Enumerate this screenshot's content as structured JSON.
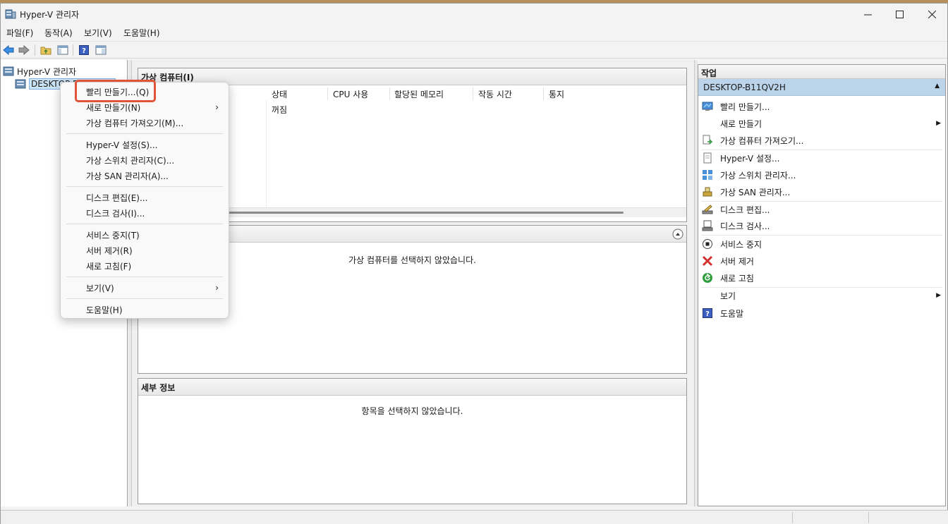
{
  "window": {
    "title": "Hyper-V 관리자"
  },
  "menubar": [
    "파일(F)",
    "동작(A)",
    "보기(V)",
    "도움말(H)"
  ],
  "tree": {
    "root": "Hyper-V 관리자",
    "server": "DESKTOP-B11QV2H"
  },
  "vm_panel": {
    "title": "가상 컴퓨터(I)",
    "columns": [
      "상태",
      "CPU 사용",
      "할당된 메모리",
      "작동 시간",
      "통지"
    ],
    "row_state": "꺼짐"
  },
  "checkpoint_panel": {
    "message": "가상 컴퓨터를 선택하지 않았습니다."
  },
  "details_panel": {
    "title": "세부 정보",
    "message": "항목을 선택하지 않았습니다."
  },
  "actions": {
    "title": "작업",
    "group": "DESKTOP-B11QV2H",
    "items": [
      {
        "label": "빨리 만들기...",
        "icon": "quick-create-icon"
      },
      {
        "label": "새로 만들기",
        "icon": "none",
        "submenu": true
      },
      {
        "label": "가상 컴퓨터 가져오기...",
        "icon": "import-vm-icon"
      },
      {
        "label": "Hyper-V 설정...",
        "icon": "settings-doc-icon"
      },
      {
        "label": "가상 스위치 관리자...",
        "icon": "virtual-switch-icon"
      },
      {
        "label": "가상 SAN 관리자...",
        "icon": "virtual-san-icon"
      },
      {
        "label": "디스크 편집...",
        "icon": "edit-disk-icon"
      },
      {
        "label": "디스크 검사...",
        "icon": "inspect-disk-icon"
      },
      {
        "label": "서비스 중지",
        "icon": "stop-service-icon"
      },
      {
        "label": "서버 제거",
        "icon": "remove-server-icon"
      },
      {
        "label": "새로 고침",
        "icon": "refresh-icon"
      },
      {
        "label": "보기",
        "icon": "none",
        "submenu": true
      },
      {
        "label": "도움말",
        "icon": "help-icon"
      }
    ]
  },
  "context_menu": {
    "items": [
      {
        "label": "빨리 만들기...(Q)"
      },
      {
        "label": "새로 만들기(N)",
        "submenu": true
      },
      {
        "label": "가상 컴퓨터 가져오기(M)..."
      },
      {
        "label": "Hyper-V 설정(S)..."
      },
      {
        "label": "가상 스위치 관리자(C)..."
      },
      {
        "label": "가상 SAN 관리자(A)..."
      },
      {
        "label": "디스크 편집(E)..."
      },
      {
        "label": "디스크 검사(I)..."
      },
      {
        "label": "서비스 중지(T)"
      },
      {
        "label": "서버 제거(R)"
      },
      {
        "label": "새로 고침(F)"
      },
      {
        "label": "보기(V)",
        "submenu": true
      },
      {
        "label": "도움말(H)"
      }
    ],
    "highlight_color": "#e0553a"
  },
  "colors": {
    "selection": "#cce4f7",
    "action_group": "#bcd4ea",
    "remove": "#d32f2f",
    "refresh": "#2e9e3e"
  }
}
